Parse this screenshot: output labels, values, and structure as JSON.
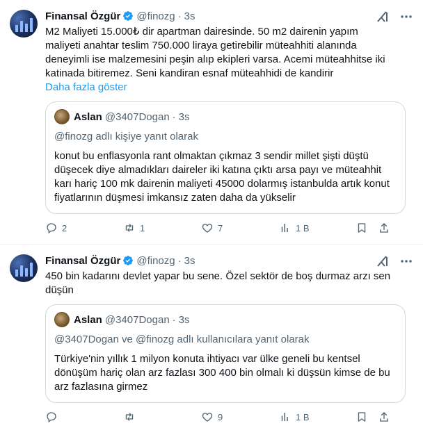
{
  "tweets": [
    {
      "author_name": "Finansal Özgür",
      "handle": "@finozg",
      "dot": "·",
      "time": "3s",
      "text": "M2 Maliyeti 15.000₺ dir apartman dairesinde. 50 m2 dairenin yapım maliyeti anahtar teslim 750.000 liraya getirebilir müteahhiti alanında deneyimli ise malzemesini peşin alıp ekipleri varsa. Acemi müteahhitse iki katinada bitiremez. Seni kandiran esnaf müteahhidi de kandirir",
      "show_more": "Daha fazla göster",
      "quote": {
        "author_name": "Aslan",
        "handle": "@3407Dogan",
        "dot": "·",
        "time": "3s",
        "reply_to": "@finozg adlı kişiye yanıt olarak",
        "text": "konut bu enflasyonla rant olmaktan çıkmaz 3 sendir millet şişti düştü düşecek diye almadıkları daireler iki katına çıktı arsa payı ve müteahhit karı hariç 100 mk dairenin maliyeti 45000 dolarmış istanbulda artık konut fiyatlarının düşmesi imkansız zaten daha da yükselir"
      },
      "actions": {
        "replies": "2",
        "reposts": "1",
        "likes": "7",
        "views": "1 B"
      }
    },
    {
      "author_name": "Finansal Özgür",
      "handle": "@finozg",
      "dot": "·",
      "time": "3s",
      "text": "450 bin kadarını devlet yapar bu sene. Özel sektör de boş durmaz arzı sen düşün",
      "quote": {
        "author_name": "Aslan",
        "handle": "@3407Dogan",
        "dot": "·",
        "time": "3s",
        "reply_to": "@3407Dogan ve @finozg adlı kullanıcılara yanıt olarak",
        "text": "Türkiye'nin yıllık 1 milyon konuta ihtiyacı var ülke geneli bu kentsel dönüşüm hariç olan arz fazlası 300 400 bin olmalı ki düşsün kimse de bu arz fazlasına girmez"
      },
      "actions": {
        "replies": "",
        "reposts": "",
        "likes": "9",
        "views": "1 B"
      }
    }
  ],
  "colors": {
    "accent": "#1d9bf0",
    "muted": "#536471",
    "border": "#cfd9de"
  },
  "icons": [
    "verified-badge-icon",
    "grok-icon",
    "more-icon",
    "reply-icon",
    "repost-icon",
    "like-icon",
    "views-icon",
    "bookmark-icon",
    "share-icon"
  ]
}
